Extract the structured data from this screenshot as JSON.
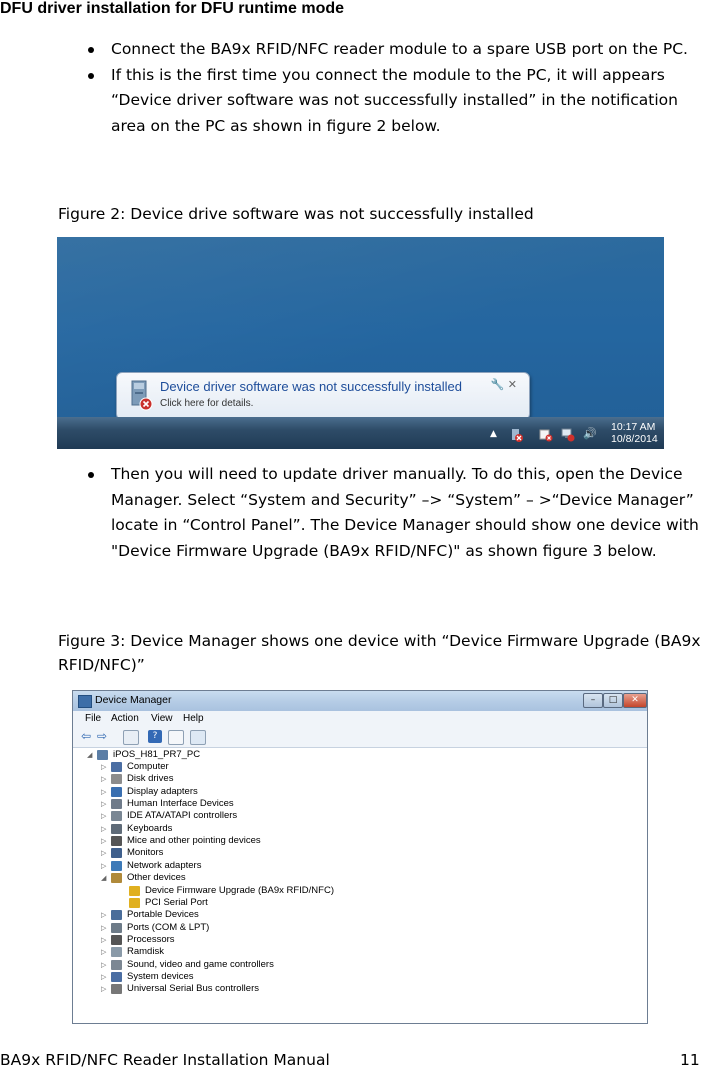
{
  "heading": "DFU driver installation for DFU runtime mode",
  "bullets_a": [
    "Connect the BA9x RFID/NFC reader module to a spare USB port on the PC.",
    "If this is the first time you connect the module to the PC, it will appears “Device driver software was not successfully installed” in the notification area on the PC as shown in figure 2 below."
  ],
  "figure2": {
    "caption": "Figure 2: Device drive software was not successfully installed",
    "balloon_title": "Device driver software was not successfully installed",
    "balloon_sub": "Click here for details.",
    "clock_time": "10:17 AM",
    "clock_date": "10/8/2014"
  },
  "bullet_b": "Then you will need to update driver manually. To do this, open the Device Manager. Select “System and Security” –> “System” – >“Device Manager” locate in “Control Panel”. The Device Manager should show one device with \"Device Firmware Upgrade (BA9x RFID/NFC)\" as shown figure 3 below.",
  "figure3": {
    "caption": "Figure 3: Device Manager shows one device with “Device Firmware Upgrade (BA9x RFID/NFC)”",
    "window_title": "Device Manager",
    "menu": [
      "File",
      "Action",
      "View",
      "Help"
    ],
    "root": "iPOS_H81_PR7_PC",
    "categories": [
      "Computer",
      "Disk drives",
      "Display adapters",
      "Human Interface Devices",
      "IDE ATA/ATAPI controllers",
      "Keyboards",
      "Mice and other pointing devices",
      "Monitors",
      "Network adapters",
      "Other devices",
      "Device Firmware Upgrade (BA9x RFID/NFC)",
      "PCI Serial Port",
      "Portable Devices",
      "Ports (COM & LPT)",
      "Processors",
      "Ramdisk",
      "Sound, video and game controllers",
      "System devices",
      "Universal Serial Bus controllers"
    ]
  },
  "footer": {
    "title": "BA9x RFID/NFC Reader Installation Manual",
    "page": "11"
  }
}
